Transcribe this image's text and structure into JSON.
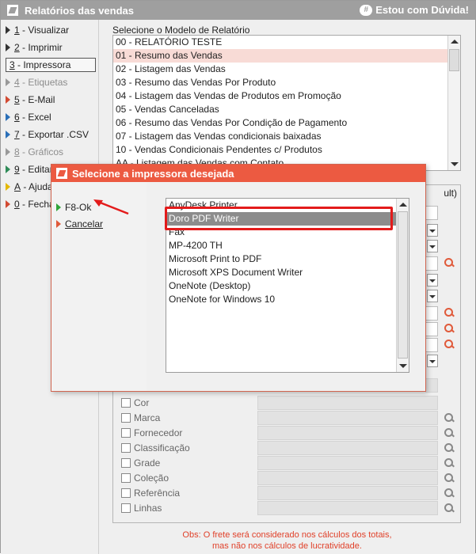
{
  "window": {
    "title": "Relatórios das vendas",
    "help_label": "Estou com Dúvida!"
  },
  "menu": [
    {
      "key": "1",
      "label": " - Visualizar",
      "state": "normal"
    },
    {
      "key": "2",
      "label": " - Imprimir",
      "state": "normal"
    },
    {
      "key": "3",
      "label": " - Impressora",
      "state": "selected"
    },
    {
      "key": "4",
      "label": " - Etiquetas",
      "state": "disabled"
    },
    {
      "key": "5",
      "label": " - E-Mail",
      "state": "normal"
    },
    {
      "key": "6",
      "label": " - Excel",
      "state": "normal"
    },
    {
      "key": "7",
      "label": " - Exportar .CSV",
      "state": "normal"
    },
    {
      "key": "8",
      "label": " - Gráficos",
      "state": "disabled"
    },
    {
      "key": "9",
      "label": " - Editar",
      "state": "normal"
    },
    {
      "key": "A",
      "label": " - Ajuda",
      "state": "normal"
    },
    {
      "key": "0",
      "label": " - Fechar",
      "state": "normal"
    }
  ],
  "report_model": {
    "label": "Selecione o Modelo de Relatório",
    "items": [
      "00 - RELATÓRIO TESTE",
      "01 - Resumo das Vendas",
      "02 - Listagem das Vendas",
      "03 - Resumo das Vendas Por Produto",
      "04 - Listagem das Vendas de Produtos em Promoção",
      "05 - Vendas Canceladas",
      "06 - Resumo das Vendas Por Condição de Pagamento",
      "07 - Listagem das Vendas condicionais baixadas",
      "10 - Vendas Condicionais Pendentes c/ Produtos",
      "AA - Listagem das Vendas com Contato"
    ],
    "selected_index": 1
  },
  "options": {
    "header_fragment": "ult)",
    "filters": [
      "Cor",
      "Marca",
      "Fornecedor",
      "Classificação",
      "Grade",
      "Coleção",
      "Referência",
      "Linhas"
    ]
  },
  "obs": {
    "line1": "Obs: O frete será considerado nos cálculos dos totais,",
    "line2": "mas não nos cálculos de lucratividade."
  },
  "printer_dialog": {
    "title": "Selecione a impressora desejada",
    "ok_label": "F8-Ok",
    "cancel_label": "Cancelar",
    "printers": [
      "AnyDesk Printer",
      "Doro PDF Writer",
      "Fax",
      "MP-4200 TH",
      "Microsoft Print to PDF",
      "Microsoft XPS Document Writer",
      "OneNote (Desktop)",
      "OneNote for Windows 10"
    ],
    "selected_index": 1
  },
  "colors": {
    "accent": "#ec5a41",
    "highlight_box": "#e31b1b",
    "ok_icon": "#2fa53a"
  }
}
